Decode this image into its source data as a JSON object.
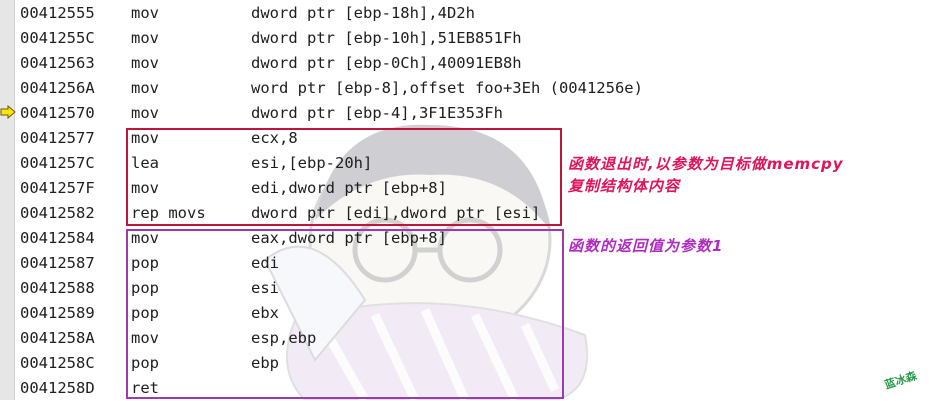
{
  "disassembly": {
    "rows": [
      {
        "address": "00412555",
        "mnemonic": "mov",
        "operands": "dword ptr [ebp-18h],4D2h"
      },
      {
        "address": "0041255C",
        "mnemonic": "mov",
        "operands": "dword ptr [ebp-10h],51EB851Fh"
      },
      {
        "address": "00412563",
        "mnemonic": "mov",
        "operands": "dword ptr [ebp-0Ch],40091EB8h"
      },
      {
        "address": "0041256A",
        "mnemonic": "mov",
        "operands": "word ptr [ebp-8],offset foo+3Eh (0041256e)"
      },
      {
        "address": "00412570",
        "mnemonic": "mov",
        "operands": "dword ptr [ebp-4],3F1E353Fh"
      },
      {
        "address": "00412577",
        "mnemonic": "mov",
        "operands": "ecx,8"
      },
      {
        "address": "0041257C",
        "mnemonic": "lea",
        "operands": "esi,[ebp-20h]"
      },
      {
        "address": "0041257F",
        "mnemonic": "mov",
        "operands": "edi,dword ptr [ebp+8]"
      },
      {
        "address": "00412582",
        "mnemonic": "rep movs",
        "operands": "dword ptr [edi],dword ptr [esi]"
      },
      {
        "address": "00412584",
        "mnemonic": "mov",
        "operands": "eax,dword ptr [ebp+8]"
      },
      {
        "address": "00412587",
        "mnemonic": "pop",
        "operands": "edi"
      },
      {
        "address": "00412588",
        "mnemonic": "pop",
        "operands": "esi"
      },
      {
        "address": "00412589",
        "mnemonic": "pop",
        "operands": "ebx"
      },
      {
        "address": "0041258A",
        "mnemonic": "mov",
        "operands": "esp,ebp"
      },
      {
        "address": "0041258C",
        "mnemonic": "pop",
        "operands": "ebp"
      },
      {
        "address": "0041258D",
        "mnemonic": "ret",
        "operands": ""
      }
    ],
    "current_instruction_index": 4
  },
  "annotations": {
    "red_note_line1": "函数退出时,以参数为目标做memcpy",
    "red_note_line2": "复制结构体内容",
    "purple_note": "函数的返回值为参数1",
    "stamp_text": "蓝冰森",
    "red_color": "#c0143c",
    "purple_color": "#9b3bb0"
  },
  "icons": {
    "instruction_pointer": "current-instruction-arrow-icon"
  }
}
